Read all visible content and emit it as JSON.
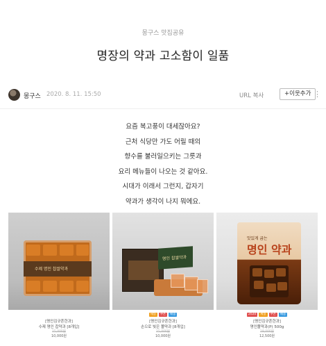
{
  "post": {
    "category": "몽구스 맛집공유",
    "title": "명장의 약과 고소함이 일품",
    "author": "몽구스",
    "date": "2020. 8. 11. 15:50",
    "url_copy_label": "URL 복사",
    "add_neighbor_label": "+이웃추가",
    "more_label": "⋮"
  },
  "body": {
    "lines": [
      "요즘 복고풍이 대세잖아요?",
      "근처 식당만 가도 어릴 때의",
      "향수를 불러일으키는 그릇과",
      "요리 메뉴들이 나오는 것 같아요.",
      "시대가 이래서 그런지, 갑자기",
      "약과가 생각이 나지 뭐에요."
    ]
  },
  "products": [
    {
      "badges": [],
      "package_text": "수제 명인 찹쌀약과",
      "brand": "[명인김규흔한과]",
      "name": "수제 명인 찹약과 [8개입]",
      "old_price": "15,000원",
      "price": "10,000원"
    },
    {
      "badges": [
        {
          "text": "세일",
          "color": "#f0a020"
        },
        {
          "text": "쿠폰",
          "color": "#e05050"
        },
        {
          "text": "배송",
          "color": "#3a9be0"
        }
      ],
      "package_text": "명인 찹쌀약과",
      "brand": "[명인김규흔한과]",
      "name": "손으로 빚은 쫄약과 [8개입]",
      "old_price": "15,000원",
      "price": "10,000원"
    },
    {
      "badges": [
        {
          "text": "2020",
          "color": "#e05050"
        },
        {
          "text": "세일",
          "color": "#f0a020"
        },
        {
          "text": "쿠폰",
          "color": "#e05050"
        },
        {
          "text": "배송",
          "color": "#3a9be0"
        }
      ],
      "package_text": "명인 약과",
      "package_subtext": "맛있게 굽는",
      "brand": "[명인김규흔한과]",
      "name": "명인쫄약과(P) 500g",
      "old_price": "19,000원",
      "price": "12,500원"
    }
  ]
}
